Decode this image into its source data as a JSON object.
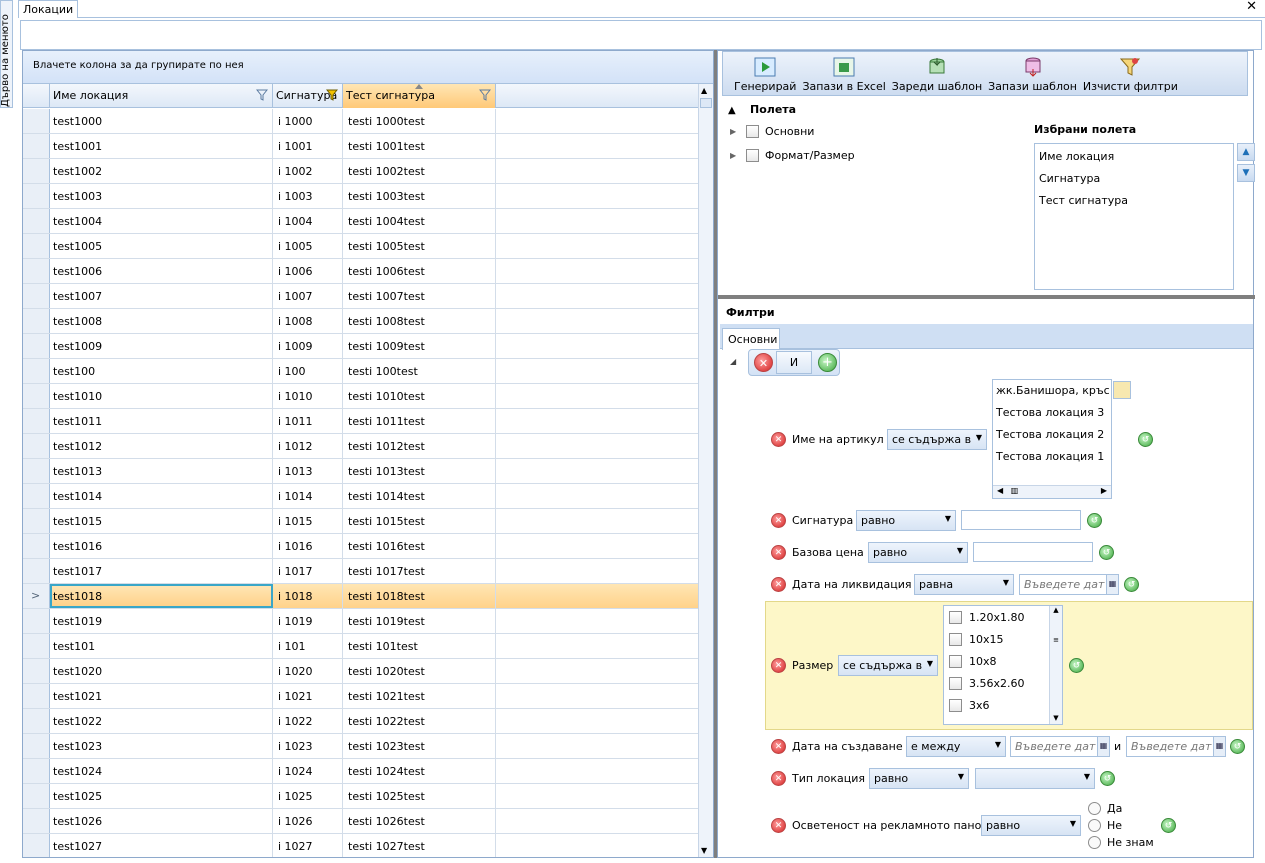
{
  "side_tab": {
    "label": "Дърво на менюто"
  },
  "doc_tab": {
    "label": "Локации"
  },
  "grid": {
    "group_hint": "Влачете колона за да групирате по нея",
    "columns": [
      "Име локация",
      "Сигнатура",
      "Тест сигнатура"
    ],
    "rows": [
      [
        "test1000",
        "i 1000",
        "testi 1000test"
      ],
      [
        "test1001",
        "i 1001",
        "testi 1001test"
      ],
      [
        "test1002",
        "i 1002",
        "testi 1002test"
      ],
      [
        "test1003",
        "i 1003",
        "testi 1003test"
      ],
      [
        "test1004",
        "i 1004",
        "testi 1004test"
      ],
      [
        "test1005",
        "i 1005",
        "testi 1005test"
      ],
      [
        "test1006",
        "i 1006",
        "testi 1006test"
      ],
      [
        "test1007",
        "i 1007",
        "testi 1007test"
      ],
      [
        "test1008",
        "i 1008",
        "testi 1008test"
      ],
      [
        "test1009",
        "i 1009",
        "testi 1009test"
      ],
      [
        "test100",
        "i 100",
        "testi 100test"
      ],
      [
        "test1010",
        "i 1010",
        "testi 1010test"
      ],
      [
        "test1011",
        "i 1011",
        "testi 1011test"
      ],
      [
        "test1012",
        "i 1012",
        "testi 1012test"
      ],
      [
        "test1013",
        "i 1013",
        "testi 1013test"
      ],
      [
        "test1014",
        "i 1014",
        "testi 1014test"
      ],
      [
        "test1015",
        "i 1015",
        "testi 1015test"
      ],
      [
        "test1016",
        "i 1016",
        "testi 1016test"
      ],
      [
        "test1017",
        "i 1017",
        "testi 1017test"
      ],
      [
        "test1018",
        "i 1018",
        "testi 1018test"
      ],
      [
        "test1019",
        "i 1019",
        "testi 1019test"
      ],
      [
        "test101",
        "i 101",
        "testi 101test"
      ],
      [
        "test1020",
        "i 1020",
        "testi 1020test"
      ],
      [
        "test1021",
        "i 1021",
        "testi 1021test"
      ],
      [
        "test1022",
        "i 1022",
        "testi 1022test"
      ],
      [
        "test1023",
        "i 1023",
        "testi 1023test"
      ],
      [
        "test1024",
        "i 1024",
        "testi 1024test"
      ],
      [
        "test1025",
        "i 1025",
        "testi 1025test"
      ],
      [
        "test1026",
        "i 1026",
        "testi 1026test"
      ],
      [
        "test1027",
        "i 1027",
        "testi 1027test"
      ]
    ],
    "active_row_index": 19
  },
  "toolbar": {
    "generate": "Генерирай",
    "export_excel": "Запази в Excel",
    "load_template": "Зареди шаблон",
    "save_template": "Запази шаблон",
    "clear_filters": "Изчисти филтри"
  },
  "fields": {
    "title": "Полета",
    "tree": [
      "Основни",
      "Формат/Размер"
    ],
    "selected_title": "Избрани полета",
    "selected": [
      "Име локация",
      "Сигнатура",
      "Тест сигнатура"
    ]
  },
  "filters": {
    "title": "Филтри",
    "tab": "Основни",
    "group_op": "И",
    "article": {
      "label": "Име на артикул",
      "op": "се съдържа в",
      "values": [
        "жк.Банишора, кръс",
        "Тестова локация 3",
        "Тестова локация 2",
        "Тестова локация 1"
      ]
    },
    "signature": {
      "label": "Сигнатура",
      "op": "равно",
      "value": ""
    },
    "base_price": {
      "label": "Базова цена",
      "op": "равно",
      "value": ""
    },
    "liquidation_date": {
      "label": "Дата на ликвидация",
      "op": "равна",
      "placeholder": "Въведете дат"
    },
    "size": {
      "label": "Размер",
      "op": "се съдържа в",
      "options": [
        "1.20x1.80",
        "10x15",
        "10x8",
        "3.56x2.60",
        "3x6"
      ]
    },
    "created_date": {
      "label": "Дата на създаване",
      "op": "е между",
      "placeholder1": "Въведете дат",
      "and": "и",
      "placeholder2": "Въведете дат"
    },
    "location_type": {
      "label": "Тип локация",
      "op": "равно",
      "value": ""
    },
    "lighting": {
      "label": "Осветеност на рекламното пано",
      "op": "равно",
      "options": [
        "Да",
        "Не",
        "Не знам"
      ]
    }
  }
}
